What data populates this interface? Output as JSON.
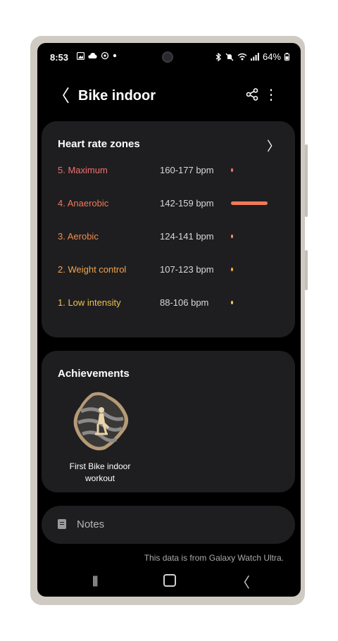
{
  "status_bar": {
    "time": "8:53",
    "left_icons": [
      "gallery-icon",
      "cloud-icon",
      "sync-icon",
      "dot-icon"
    ],
    "right_icons": [
      "bluetooth-icon",
      "mute-icon",
      "wifi-icon",
      "signal-icon"
    ],
    "battery": "64%"
  },
  "app_bar": {
    "back_glyph": "〈",
    "title": "Bike indoor",
    "more_glyph": "⋮"
  },
  "heart_rate_zones": {
    "header": "Heart rate zones",
    "chevron": "〉",
    "zones": [
      {
        "name": "5. Maximum",
        "range": "160-177 bpm",
        "color": "#f0716a",
        "share": 0.04
      },
      {
        "name": "4. Anaerobic",
        "range": "142-159 bpm",
        "color": "#f07a57",
        "share": 0.9
      },
      {
        "name": "3. Aerobic",
        "range": "124-141 bpm",
        "color": "#f28b4e",
        "share": 0.04
      },
      {
        "name": "2. Weight control",
        "range": "107-123 bpm",
        "color": "#f2a44a",
        "share": 0.02
      },
      {
        "name": "1. Low intensity",
        "range": "88-106 bpm",
        "color": "#f2c04a",
        "share": 0.02
      }
    ]
  },
  "achievements": {
    "title": "Achievements",
    "items": [
      {
        "label": "First Bike indoor workout",
        "icon": "bike-badge-icon"
      }
    ]
  },
  "notes": {
    "label": "Notes",
    "icon": "notes-icon"
  },
  "source_text": "This data is from Galaxy Watch Ultra.",
  "nav_bar": {
    "recents_glyph": "|||",
    "back_glyph": "〈"
  }
}
